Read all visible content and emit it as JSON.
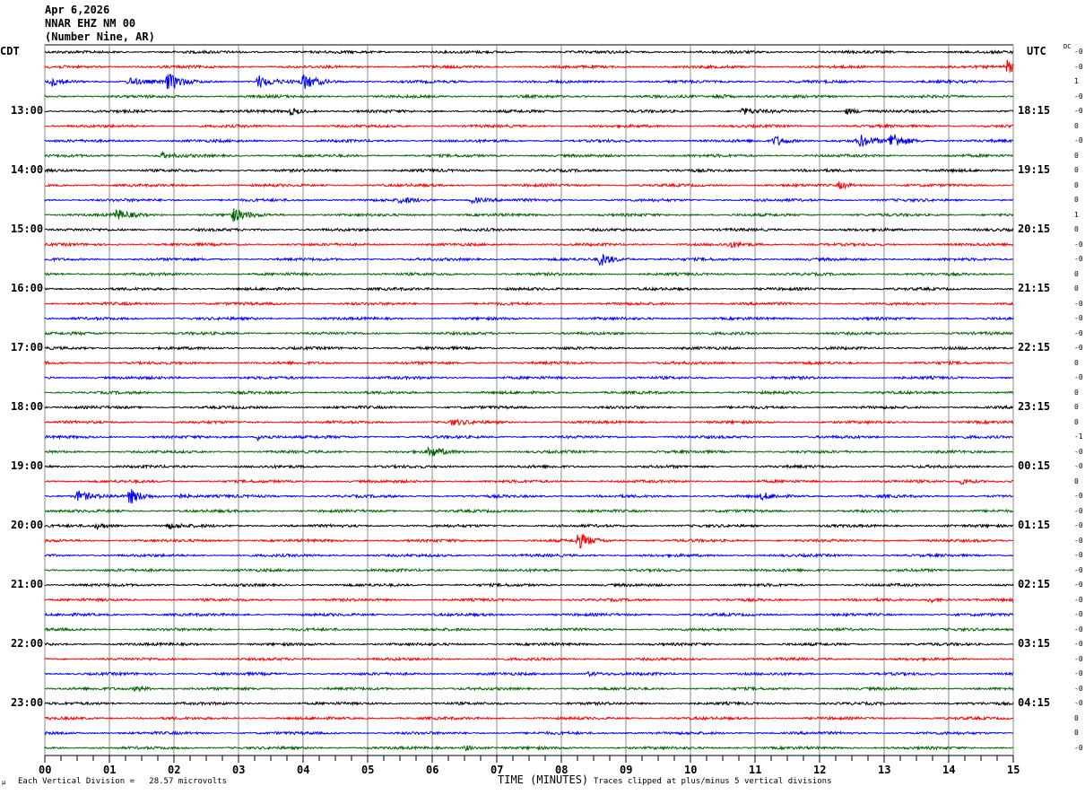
{
  "header": {
    "date": "Apr 6,2026",
    "station": "NNAR EHZ NM 00",
    "location": "(Number Nine, AR)"
  },
  "left_timezone": "CDT",
  "right_timezone": "UTC",
  "dc_label": "DC",
  "footer": {
    "scale": "Each Vertical Division =   28.57 microvolts",
    "scale_mark": "μ",
    "xlabel": "TIME (MINUTES)",
    "clip_note": "Traces clipped at plus/minus 5 vertical divisions"
  },
  "chart_data": {
    "type": "line",
    "title": "NNAR EHZ NM 00 helicorder",
    "xlabel": "TIME (MINUTES)",
    "xlim": [
      0,
      15
    ],
    "x_ticks": [
      "00",
      "01",
      "02",
      "03",
      "04",
      "05",
      "06",
      "07",
      "08",
      "09",
      "10",
      "11",
      "12",
      "13",
      "14",
      "15"
    ],
    "trace_count": 48,
    "trace_colors": [
      "#000000",
      "#ff0000",
      "#0000ff",
      "#006400"
    ],
    "left_hour_labels": [
      {
        "trace": 4,
        "label": "13:00"
      },
      {
        "trace": 8,
        "label": "14:00"
      },
      {
        "trace": 12,
        "label": "15:00"
      },
      {
        "trace": 16,
        "label": "16:00"
      },
      {
        "trace": 20,
        "label": "17:00"
      },
      {
        "trace": 24,
        "label": "18:00"
      },
      {
        "trace": 28,
        "label": "19:00"
      },
      {
        "trace": 32,
        "label": "20:00"
      },
      {
        "trace": 36,
        "label": "21:00"
      },
      {
        "trace": 40,
        "label": "22:00"
      },
      {
        "trace": 44,
        "label": "23:00"
      }
    ],
    "right_hour_labels": [
      {
        "trace": 4,
        "label": "18:15"
      },
      {
        "trace": 8,
        "label": "19:15"
      },
      {
        "trace": 12,
        "label": "20:15"
      },
      {
        "trace": 16,
        "label": "21:15"
      },
      {
        "trace": 20,
        "label": "22:15"
      },
      {
        "trace": 24,
        "label": "23:15"
      },
      {
        "trace": 28,
        "label": "00:15"
      },
      {
        "trace": 32,
        "label": "01:15"
      },
      {
        "trace": 36,
        "label": "02:15"
      },
      {
        "trace": 40,
        "label": "03:15"
      },
      {
        "trace": 44,
        "label": "04:15"
      }
    ],
    "dc_offsets": [
      "-0",
      "-0",
      "1",
      "-0",
      "-0",
      "0",
      "-0",
      "0",
      "0",
      "0",
      "0",
      "1",
      "0",
      "-0",
      "-0",
      "0",
      "0",
      "-0",
      "-0",
      "-0",
      "-0",
      "0",
      "-0",
      "0",
      "0",
      "0",
      "-1",
      "-0",
      "-0",
      "0",
      "-0",
      "-0",
      "-0",
      "-0",
      "-0",
      "-0",
      "-0",
      "-0",
      "-0",
      "-0",
      "-0",
      "-0",
      "-0",
      "-0",
      "-0",
      "0",
      "0",
      "-0"
    ],
    "events": [
      {
        "trace": 1,
        "minute": 14.9,
        "amplitude": 2.5
      },
      {
        "trace": 2,
        "minute": 0.1,
        "amplitude": 1.5
      },
      {
        "trace": 2,
        "minute": 1.3,
        "amplitude": 1.5
      },
      {
        "trace": 2,
        "minute": 1.9,
        "amplitude": 3.5
      },
      {
        "trace": 2,
        "minute": 3.3,
        "amplitude": 2.5
      },
      {
        "trace": 2,
        "minute": 4.0,
        "amplitude": 3
      },
      {
        "trace": 3,
        "minute": 10.4,
        "amplitude": 1
      },
      {
        "trace": 4,
        "minute": 3.8,
        "amplitude": 1.2
      },
      {
        "trace": 4,
        "minute": 10.8,
        "amplitude": 1.2
      },
      {
        "trace": 4,
        "minute": 12.4,
        "amplitude": 1.2
      },
      {
        "trace": 6,
        "minute": 11.3,
        "amplitude": 2
      },
      {
        "trace": 6,
        "minute": 12.6,
        "amplitude": 2.5
      },
      {
        "trace": 6,
        "minute": 13.1,
        "amplitude": 3.5
      },
      {
        "trace": 7,
        "minute": 1.8,
        "amplitude": 1
      },
      {
        "trace": 9,
        "minute": 12.3,
        "amplitude": 1.2
      },
      {
        "trace": 10,
        "minute": 5.5,
        "amplitude": 1.2
      },
      {
        "trace": 10,
        "minute": 6.6,
        "amplitude": 1.2
      },
      {
        "trace": 11,
        "minute": 1.1,
        "amplitude": 2
      },
      {
        "trace": 11,
        "minute": 2.9,
        "amplitude": 2.5
      },
      {
        "trace": 13,
        "minute": 10.6,
        "amplitude": 1
      },
      {
        "trace": 14,
        "minute": 8.6,
        "amplitude": 2.5
      },
      {
        "trace": 25,
        "minute": 6.3,
        "amplitude": 1
      },
      {
        "trace": 26,
        "minute": 3.3,
        "amplitude": 1.2
      },
      {
        "trace": 27,
        "minute": 5.95,
        "amplitude": 2
      },
      {
        "trace": 29,
        "minute": 14.2,
        "amplitude": 1.2
      },
      {
        "trace": 30,
        "minute": 0.5,
        "amplitude": 2
      },
      {
        "trace": 30,
        "minute": 1.3,
        "amplitude": 3
      },
      {
        "trace": 30,
        "minute": 2.0,
        "amplitude": 1.2
      },
      {
        "trace": 30,
        "minute": 11.1,
        "amplitude": 1.2
      },
      {
        "trace": 32,
        "minute": 0.8,
        "amplitude": 1
      },
      {
        "trace": 32,
        "minute": 1.9,
        "amplitude": 1
      },
      {
        "trace": 33,
        "minute": 8.25,
        "amplitude": 3
      },
      {
        "trace": 37,
        "minute": 13.7,
        "amplitude": 1
      },
      {
        "trace": 42,
        "minute": 8.4,
        "amplitude": 0.8
      },
      {
        "trace": 43,
        "minute": 1.4,
        "amplitude": 1
      },
      {
        "trace": 47,
        "minute": 6.5,
        "amplitude": 1
      }
    ]
  }
}
